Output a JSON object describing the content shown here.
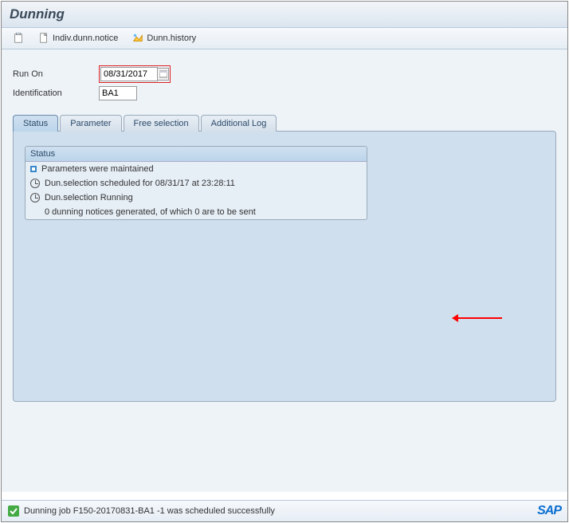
{
  "header": {
    "title": "Dunning"
  },
  "toolbar": {
    "indiv_label": "Indiv.dunn.notice",
    "history_label": "Dunn.history"
  },
  "fields": {
    "run_on_label": "Run On",
    "run_on_value": "08/31/2017",
    "ident_label": "Identification",
    "ident_value": "BA1"
  },
  "tabs": [
    "Status",
    "Parameter",
    "Free selection",
    "Additional Log"
  ],
  "status": {
    "title": "Status",
    "rows": [
      "Parameters were maintained",
      "Dun.selection scheduled for 08/31/17   at 23:28:11",
      "Dun.selection Running",
      "0 dunning notices generated, of which 0 are to be sent"
    ]
  },
  "statusbar": {
    "message": "Dunning job F150-20170831-BA1   -1 was scheduled successfully",
    "logo": "SAP"
  }
}
